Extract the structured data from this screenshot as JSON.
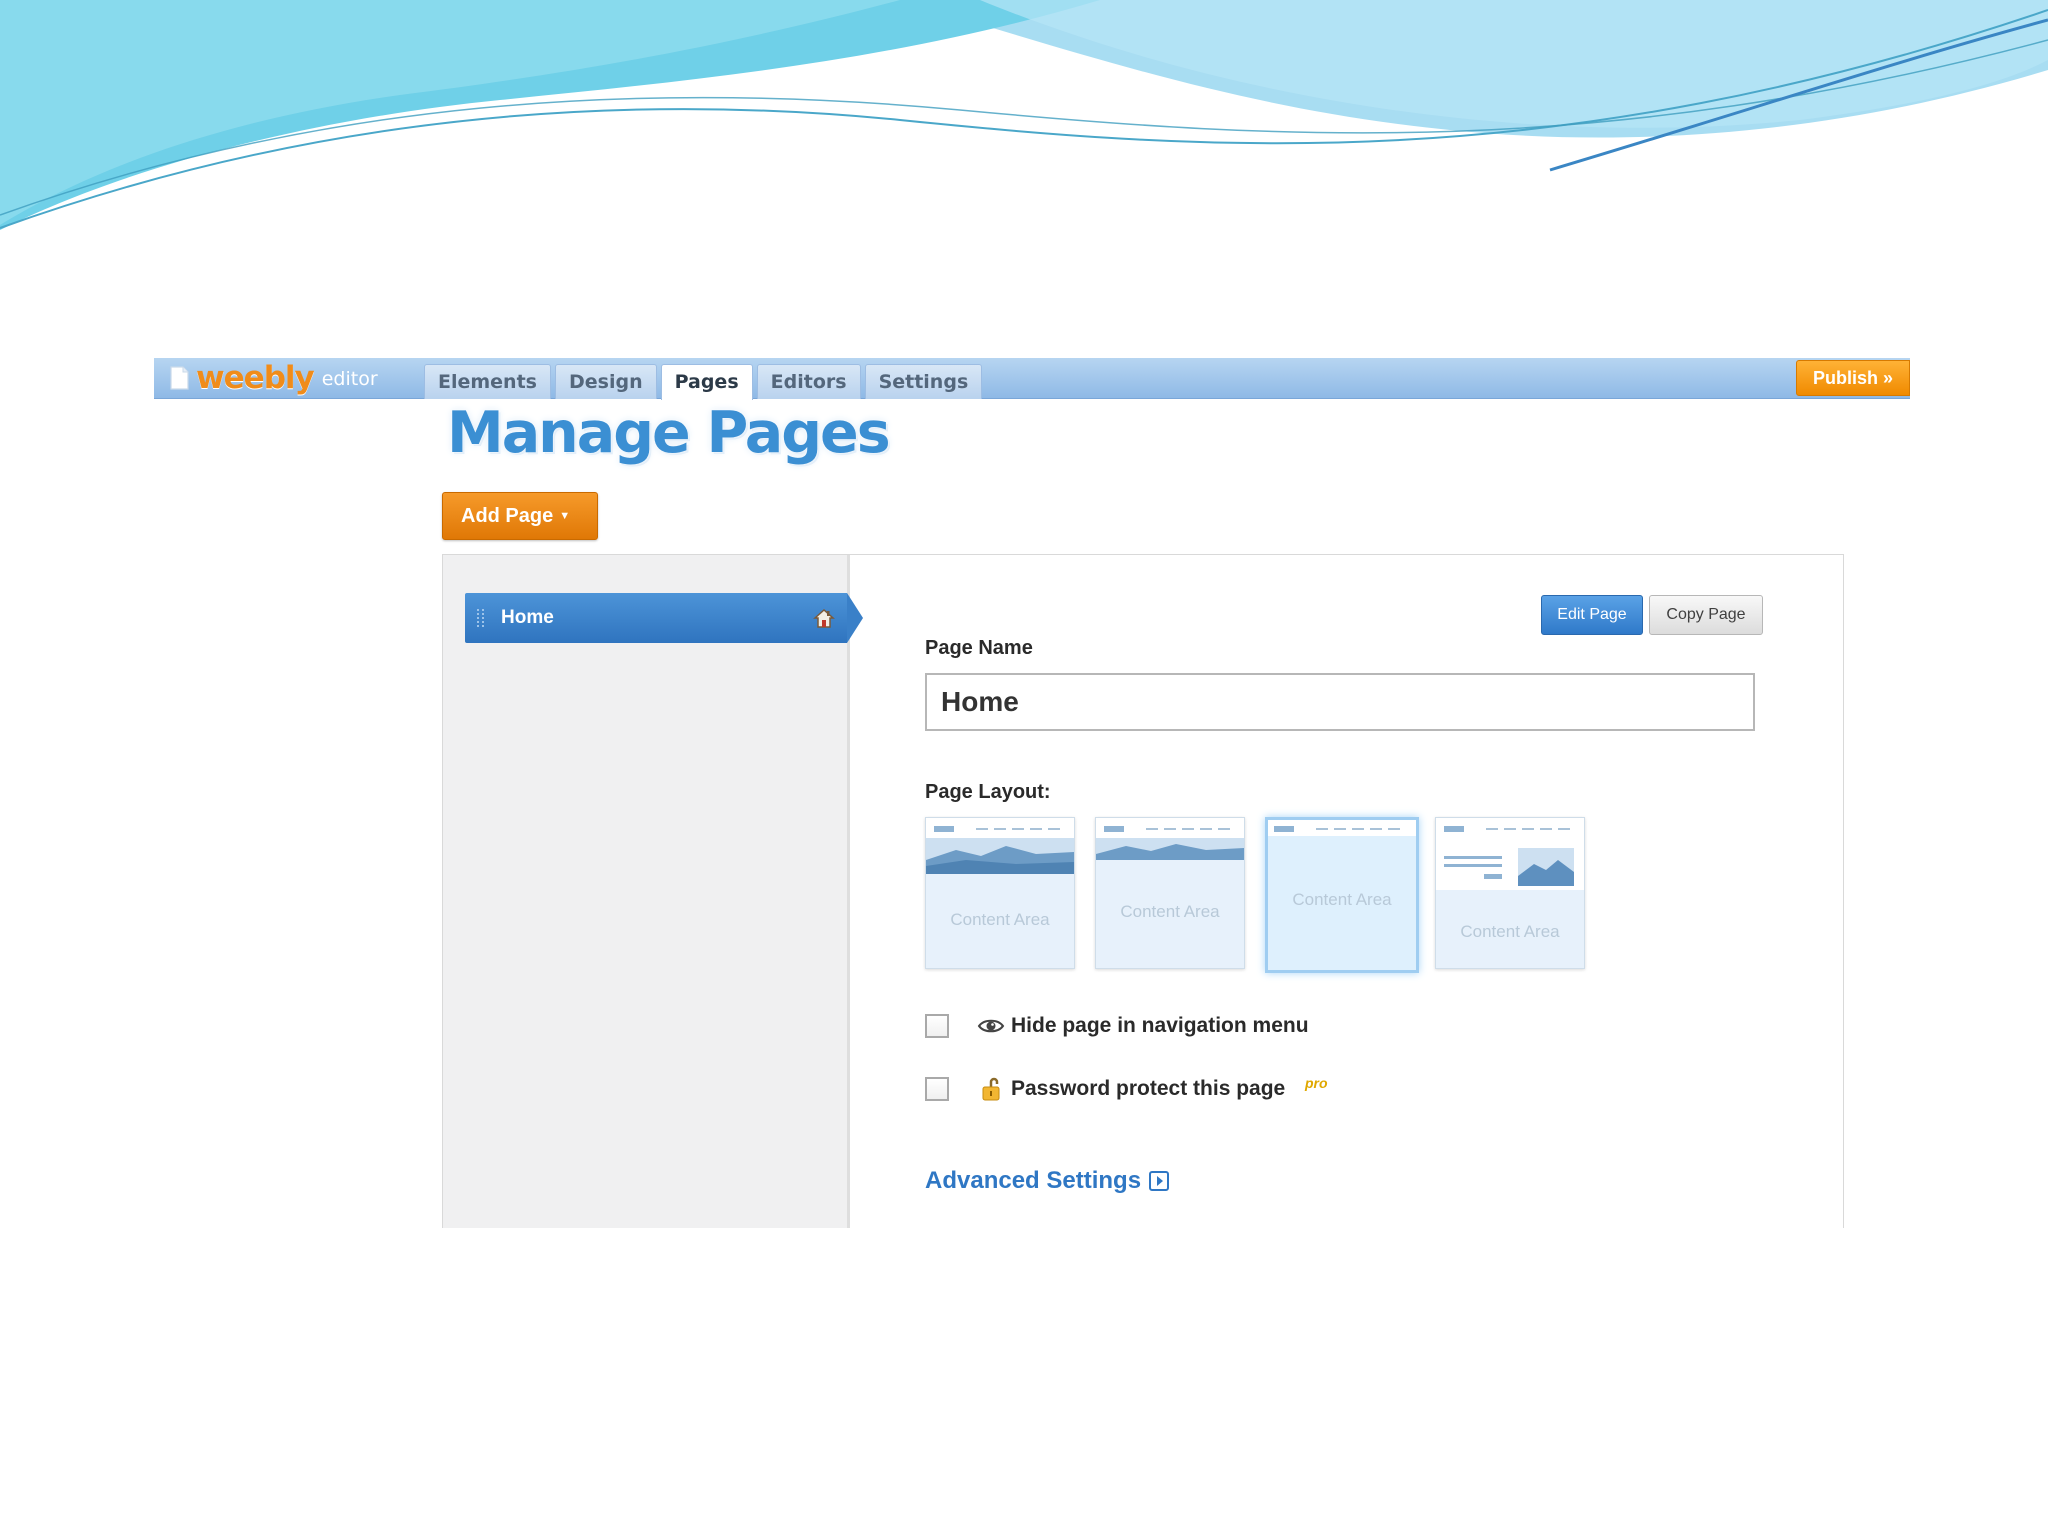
{
  "slide": {
    "wave_colors": [
      "#62cde6",
      "#8fd3ef",
      "#a8dcf3"
    ]
  },
  "app": {
    "logo": {
      "word": "weebly",
      "sub": "editor"
    },
    "tabs": [
      {
        "label": "Elements",
        "active": false
      },
      {
        "label": "Design",
        "active": false
      },
      {
        "label": "Pages",
        "active": true
      },
      {
        "label": "Editors",
        "active": false
      },
      {
        "label": "Settings",
        "active": false
      }
    ],
    "publish_label": "Publish »",
    "page_title": "Manage Pages",
    "add_page_label": "Add Page",
    "pages_list": [
      {
        "label": "Home",
        "selected": true,
        "icon": "house-icon"
      }
    ],
    "edit_page_label": "Edit Page",
    "copy_page_label": "Copy Page",
    "page_name_label": "Page Name",
    "page_name_value": "Home",
    "page_layout_label": "Page Layout:",
    "layouts": [
      {
        "label": "Content Area",
        "selected": false,
        "kind": "tall-header"
      },
      {
        "label": "Content Area",
        "selected": false,
        "kind": "short-header"
      },
      {
        "label": "Content Area",
        "selected": true,
        "kind": "no-header"
      },
      {
        "label": "Content Area",
        "selected": false,
        "kind": "text-image-header"
      }
    ],
    "options": [
      {
        "label": "Hide page in navigation menu",
        "checked": false,
        "icon": "eye-icon"
      },
      {
        "label": "Password protect this page",
        "checked": false,
        "icon": "lock-icon",
        "badge": "pro"
      }
    ],
    "advanced_settings_label": "Advanced Settings",
    "colors": {
      "accent_blue": "#2f77c4",
      "accent_orange": "#f08a00"
    }
  }
}
